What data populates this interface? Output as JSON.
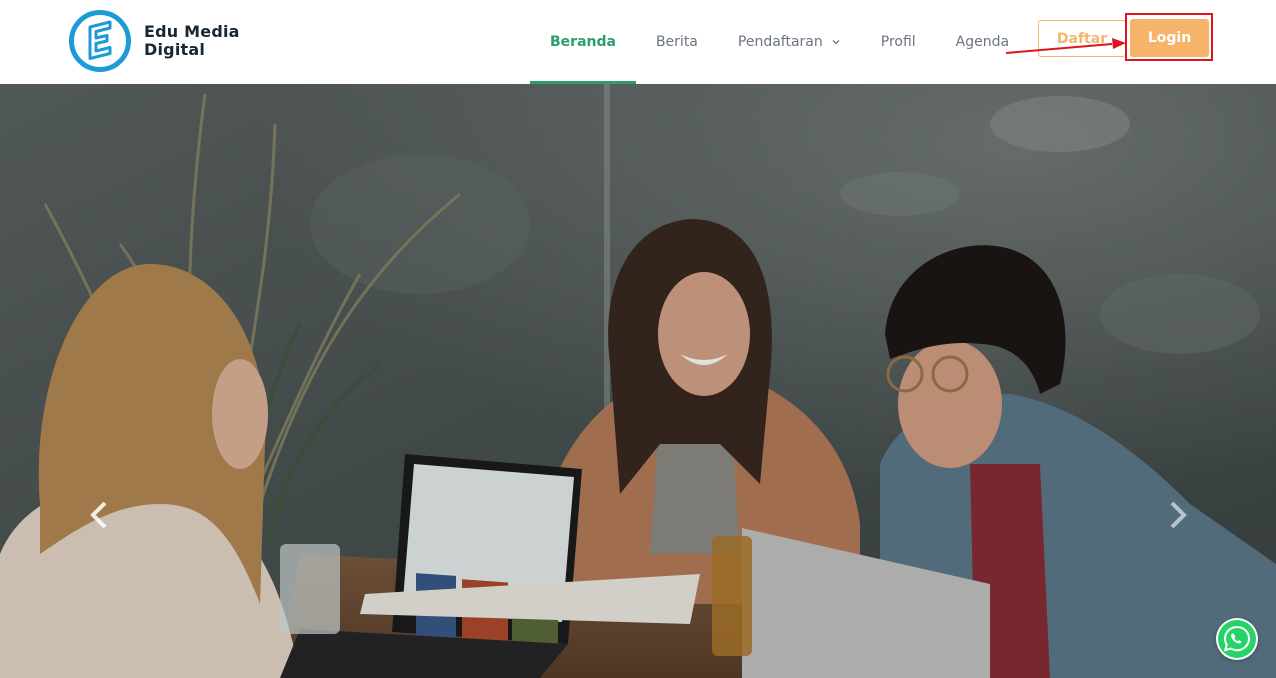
{
  "brand": {
    "line1": "Edu Media",
    "line2": "Digital",
    "color": "#1e9ad6"
  },
  "nav": {
    "items": [
      {
        "label": "Beranda",
        "active": true
      },
      {
        "label": "Berita",
        "active": false
      },
      {
        "label": "Pendaftaran",
        "active": false,
        "dropdown": true
      },
      {
        "label": "Profil",
        "active": false
      },
      {
        "label": "Agenda",
        "active": false
      }
    ],
    "active_color": "#2e9d6c"
  },
  "actions": {
    "register_label": "Daftar",
    "login_label": "Login",
    "accent_color": "#f5b46a"
  },
  "annotation": {
    "highlight_target": "Login",
    "highlight_color": "#e0141c"
  },
  "hero": {
    "prev_icon": "chevron-left-icon",
    "next_icon": "chevron-right-icon"
  },
  "floating": {
    "icon": "whatsapp-icon",
    "color": "#25d366"
  }
}
